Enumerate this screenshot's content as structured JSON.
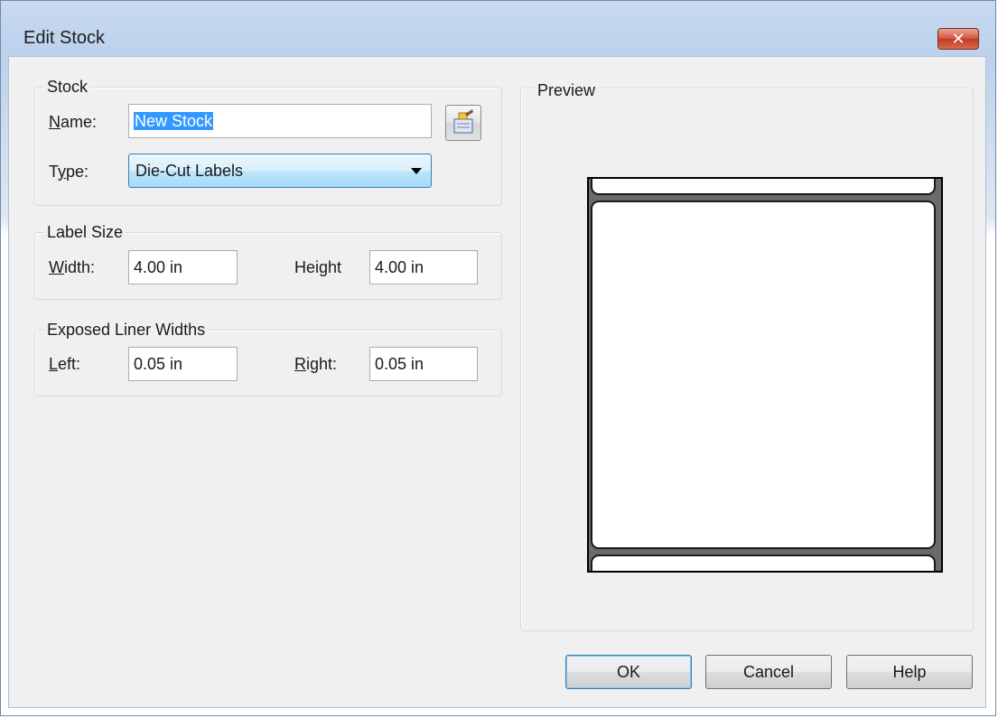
{
  "window": {
    "title": "Edit Stock",
    "close_glyph": "✕"
  },
  "stock_group": {
    "legend": "Stock",
    "name_label_key": "N",
    "name_label_rest": "ame:",
    "name_value": "New Stock",
    "type_label_prefix": "T",
    "type_label_key": "y",
    "type_label_rest": "pe:",
    "type_value": "Die-Cut Labels",
    "browse_icon": "stock-properties-icon"
  },
  "label_size_group": {
    "legend": "Label Size",
    "width_label_key": "W",
    "width_label_rest": "idth:",
    "width_value": "4.00 in",
    "height_label": "Height",
    "height_value": "4.00 in"
  },
  "liner_group": {
    "legend": "Exposed Liner Widths",
    "left_label_key": "L",
    "left_label_rest": "eft:",
    "left_value": "0.05 in",
    "right_label_key": "R",
    "right_label_rest": "ight:",
    "right_value": "0.05 in"
  },
  "preview": {
    "legend": "Preview"
  },
  "buttons": {
    "ok": "OK",
    "cancel": "Cancel",
    "help": "Help"
  }
}
